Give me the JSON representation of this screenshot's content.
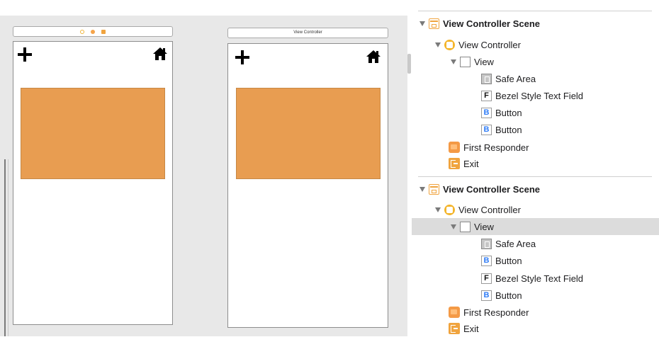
{
  "canvas": {
    "scene_a": {
      "title": ""
    },
    "scene_b": {
      "title": "View Controller"
    }
  },
  "outline": {
    "scenes": [
      {
        "scene_label": "View Controller Scene",
        "controller_label": "View Controller",
        "view_label": "View",
        "children": [
          {
            "icon": "safe-area-icon",
            "label": "Safe Area"
          },
          {
            "icon": "text-field-icon",
            "letter": "F",
            "label": "Bezel Style Text Field"
          },
          {
            "icon": "button-icon",
            "letter": "B",
            "label": "Button"
          },
          {
            "icon": "button-icon",
            "letter": "B",
            "label": "Button"
          }
        ],
        "first_responder_label": "First Responder",
        "exit_label": "Exit"
      },
      {
        "scene_label": "View Controller Scene",
        "controller_label": "View Controller",
        "view_label": "View",
        "view_selected": true,
        "children": [
          {
            "icon": "safe-area-icon",
            "label": "Safe Area"
          },
          {
            "icon": "button-icon",
            "letter": "B",
            "label": "Button"
          },
          {
            "icon": "text-field-icon",
            "letter": "F",
            "label": "Bezel Style Text Field"
          },
          {
            "icon": "button-icon",
            "letter": "B",
            "label": "Button"
          }
        ],
        "first_responder_label": "First Responder",
        "exit_label": "Exit"
      }
    ]
  },
  "colors": {
    "orange_rect": "#e89d51",
    "accent_orange": "#f0a43f",
    "button_letter": "#2f7cf6",
    "selection": "#dcdcdc"
  }
}
